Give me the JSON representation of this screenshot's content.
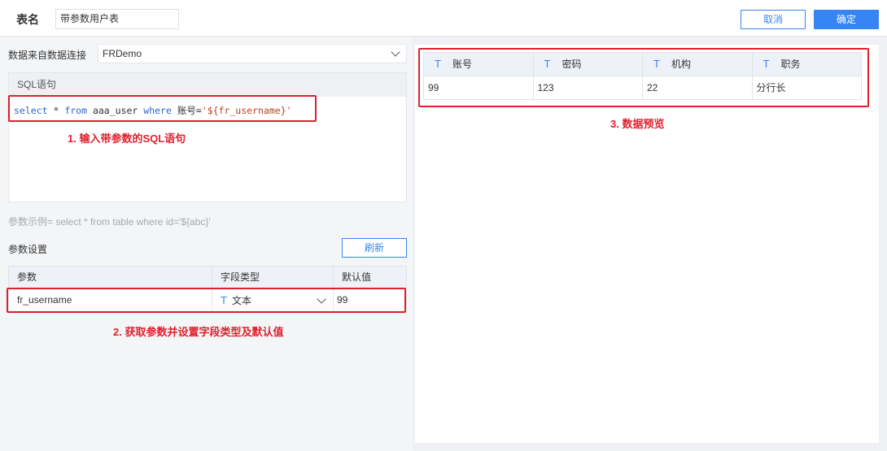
{
  "header": {
    "table_name_label": "表名",
    "table_name_value": "带参数用户表",
    "cancel_label": "取消",
    "confirm_label": "确定"
  },
  "connection": {
    "label": "数据来自数据连接",
    "selected": "FRDemo"
  },
  "sql": {
    "title": "SQL语句",
    "parts": {
      "kw_select": "select",
      "star": " * ",
      "kw_from": "from",
      "table": " aaa_user ",
      "kw_where": "where",
      "cond": " 账号=",
      "value": "'${fr_username}'"
    },
    "hint": "参数示例= select * from table where id='${abc}'"
  },
  "annotations": {
    "step1": "1. 输入带参数的SQL语句",
    "step2": "2. 获取参数并设置字段类型及默认值",
    "step3": "3. 数据预览"
  },
  "params": {
    "label": "参数设置",
    "refresh_label": "刷新",
    "headers": [
      "参数",
      "字段类型",
      "默认值"
    ],
    "rows": [
      {
        "name": "fr_username",
        "type_icon": "T",
        "type": "文本",
        "default": "99"
      }
    ]
  },
  "preview": {
    "columns": [
      {
        "icon": "T",
        "name": "账号"
      },
      {
        "icon": "T",
        "name": "密码"
      },
      {
        "icon": "T",
        "name": "机构"
      },
      {
        "icon": "T",
        "name": "职务"
      }
    ],
    "rows": [
      [
        "99",
        "123",
        "22",
        "分行长"
      ]
    ]
  },
  "colors": {
    "accent": "#3685f2",
    "annotation": "#e0202c",
    "keyword": "#2b67c9",
    "string": "#b2451f"
  }
}
